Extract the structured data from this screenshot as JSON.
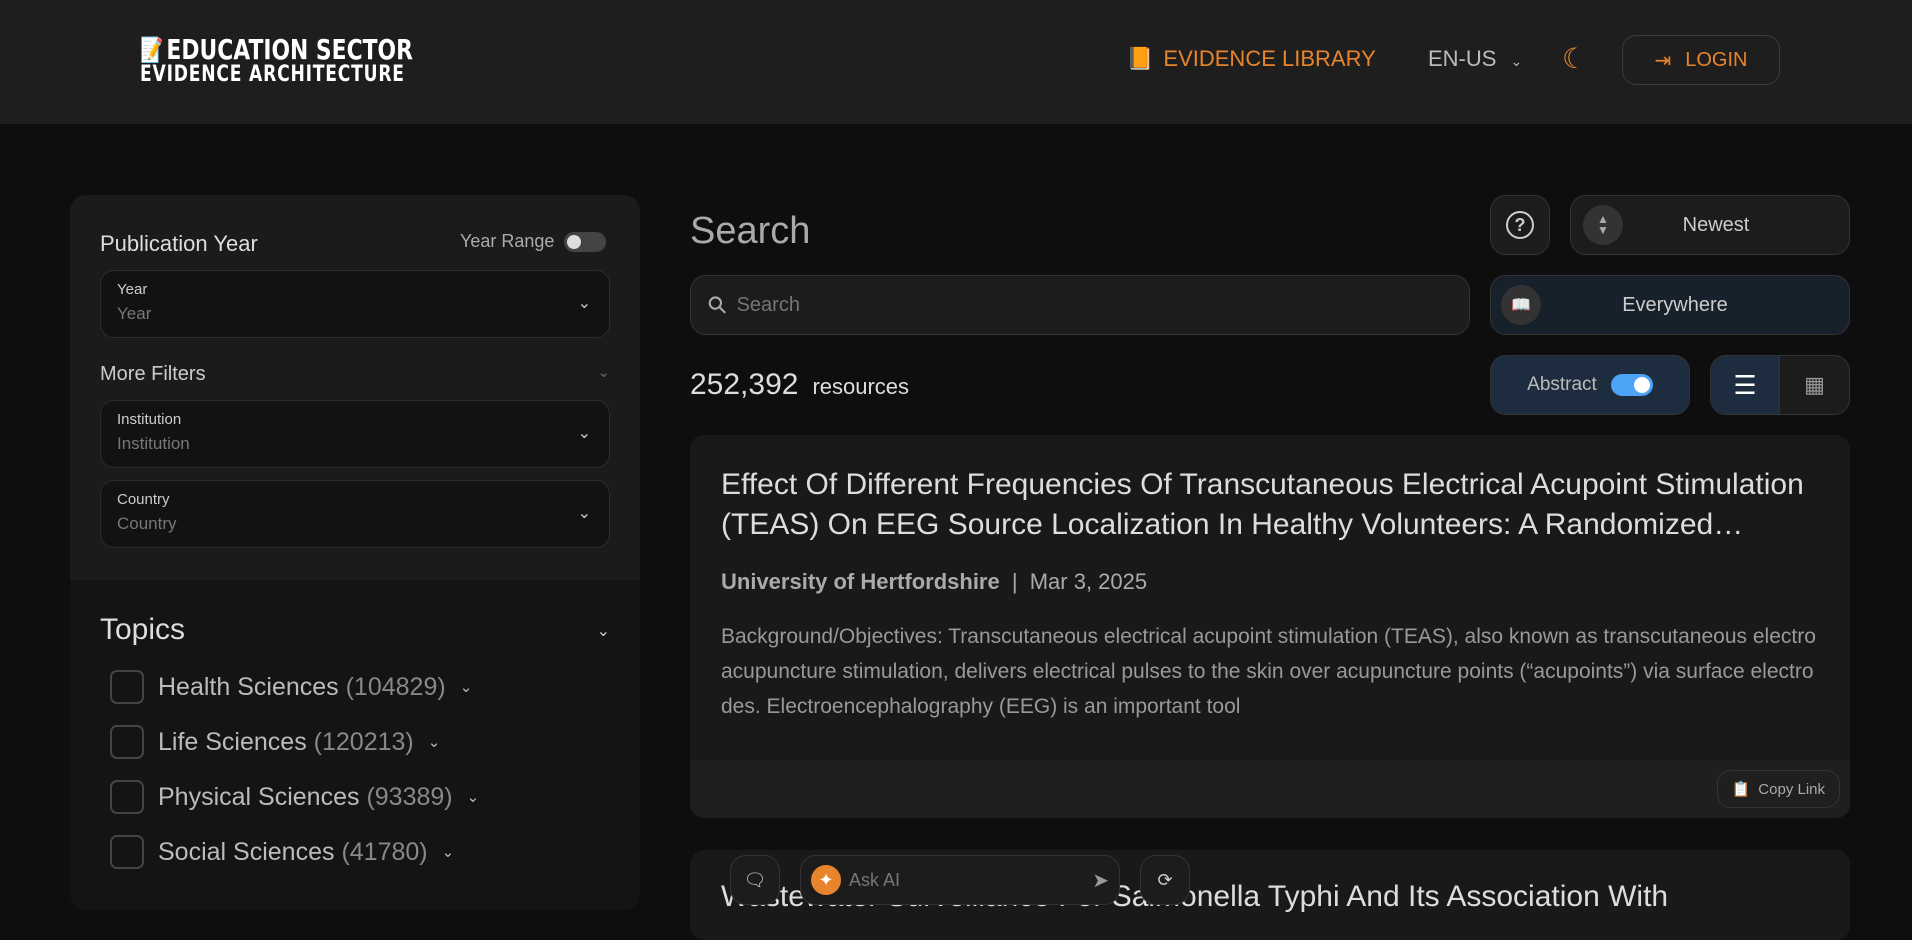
{
  "header": {
    "logo_line1": "EDUCATION SECTOR",
    "logo_line2": "EVIDENCE ARCHITECTURE",
    "nav_library": "EVIDENCE LIBRARY",
    "language": "EN-US",
    "login": "LOGIN"
  },
  "filters": {
    "publication_year": "Publication Year",
    "year_range": "Year Range",
    "year_label": "Year",
    "year_placeholder": "Year",
    "more_filters": "More Filters",
    "institution_label": "Institution",
    "institution_placeholder": "Institution",
    "country_label": "Country",
    "country_placeholder": "Country",
    "topics_title": "Topics",
    "topics": [
      {
        "name": "Health Sciences",
        "count": "(104829)"
      },
      {
        "name": "Life Sciences",
        "count": "(120213)"
      },
      {
        "name": "Physical Sciences",
        "count": "(93389)"
      },
      {
        "name": "Social Sciences",
        "count": "(41780)"
      }
    ]
  },
  "main": {
    "title": "Search",
    "sort": "Newest",
    "search_placeholder": "Search",
    "scope": "Everywhere",
    "count": "252,392",
    "count_label": "resources",
    "abstract_label": "Abstract",
    "abstract_on": true
  },
  "results": [
    {
      "title": "Effect Of Different Frequencies Of Transcutaneous Electrical Acupoint Stimulation (TEAS) On EEG Source Localization In Healthy Volunteers: A Randomized Controlled Trial",
      "institution": "University of Hertfordshire",
      "date": "Mar 3, 2025",
      "abstract": "Background/Objectives: Transcutaneous electrical acupoint stimulation (TEAS), also known as transcutaneous electroacupuncture stimulation, delivers electrical pulses to the skin over acupuncture points (“acupoints”) via surface electrodes. Electroencephalography (EEG) is an important tool",
      "copy_link": "Copy Link"
    },
    {
      "title": "Wastewater Surveillance For Salmonella Typhi And Its Association With"
    }
  ],
  "ai": {
    "placeholder": "Ask AI"
  },
  "colors": {
    "accent": "#e8852c",
    "toggle_on": "#4da3f5"
  }
}
